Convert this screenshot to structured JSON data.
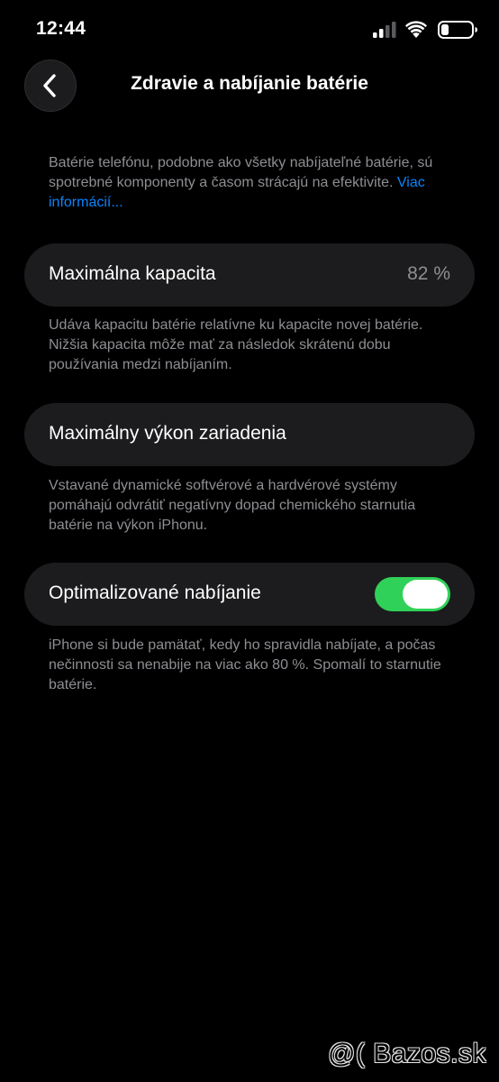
{
  "status_bar": {
    "time": "12:44",
    "icons": [
      "signal-icon",
      "wifi-icon",
      "battery-icon"
    ]
  },
  "nav": {
    "back_icon": "chevron-left-icon",
    "title": "Zdravie a nabíjanie batérie"
  },
  "intro": {
    "text": "Batérie telefónu, podobne ako všetky nabíjateľné batérie, sú spotrebné komponenty a časom strácajú na efektivite. ",
    "link": "Viac informácií..."
  },
  "max_capacity": {
    "label": "Maximálna kapacita",
    "value": "82 %",
    "footnote": "Udáva kapacitu batérie relatívne ku kapacite novej batérie. Nižšia kapacita môže mať za následok skrátenú dobu používania medzi nabíjaním."
  },
  "peak_performance": {
    "label": "Maximálny výkon zariadenia",
    "footnote": "Vstavané dynamické softvérové a hardvérové systémy pomáhajú odvrátiť negatívny dopad chemického starnutia batérie na výkon iPhonu."
  },
  "optimized_charging": {
    "label": "Optimalizované nabíjanie",
    "enabled": true,
    "footnote": "iPhone si bude pamätať, kedy ho spravidla nabíjate, a počas nečinnosti sa nenabije na viac ako 80 %. Spomalí to starnutie batérie."
  },
  "watermark": "@( Bazos.sk",
  "colors": {
    "background": "#000000",
    "card": "#1c1c1e",
    "secondary_text": "#8e8e93",
    "link": "#0a84ff",
    "toggle_on": "#30d158"
  }
}
